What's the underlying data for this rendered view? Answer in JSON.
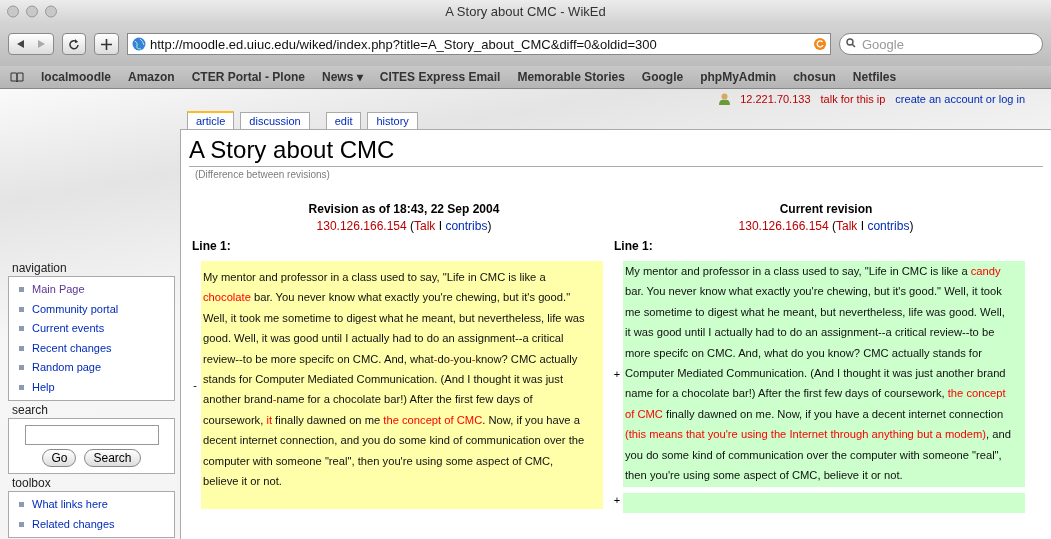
{
  "window": {
    "title": "A Story about CMC - WikEd"
  },
  "toolbar": {
    "url": "http://moodle.ed.uiuc.edu/wiked/index.php?title=A_Story_about_CMC&diff=0&oldid=300",
    "search": {
      "placeholder": "Google"
    }
  },
  "bookmarks": [
    "localmoodle",
    "Amazon",
    "CTER Portal - Plone",
    "News ▾",
    "CITES Express Email",
    "Memorable Stories",
    "Google",
    "phpMyAdmin",
    "chosun",
    "Netfiles"
  ],
  "user_bar": {
    "ip": "12.221.70.133",
    "talk": "talk for this ip",
    "login": "create an account or log in"
  },
  "tabs": [
    {
      "label": "article",
      "selected": true
    },
    {
      "label": "discussion",
      "selected": false
    },
    {
      "label": "edit",
      "selected": false
    },
    {
      "label": "history",
      "selected": false
    }
  ],
  "title": "A Story about CMC",
  "subtitle": "(Difference between revisions)",
  "sidebar": [
    {
      "kind": "links",
      "title": "navigation",
      "items": [
        {
          "label": "Main Page",
          "visited": true
        },
        {
          "label": "Community portal",
          "visited": false
        },
        {
          "label": "Current events",
          "visited": false
        },
        {
          "label": "Recent changes",
          "visited": false
        },
        {
          "label": "Random page",
          "visited": false
        },
        {
          "label": "Help",
          "visited": false
        }
      ]
    },
    {
      "kind": "search",
      "title": "search",
      "buttons": [
        "Go",
        "Search"
      ]
    },
    {
      "kind": "links",
      "title": "toolbox",
      "items": [
        {
          "label": "What links here",
          "visited": false
        },
        {
          "label": "Related changes",
          "visited": false
        }
      ]
    }
  ],
  "diff": {
    "columns": [
      {
        "kind": "deleted",
        "heading": "Revision as of 18:43, 22 Sep 2004",
        "author": [
          {
            "text": "130.126.166.154",
            "kind": "new"
          },
          {
            "text": " (",
            "kind": "plain"
          },
          {
            "text": "Talk",
            "kind": "new"
          },
          {
            "text": " I ",
            "kind": "plain"
          },
          {
            "text": "contribs",
            "kind": "link"
          },
          {
            "text": ")",
            "kind": "plain"
          }
        ],
        "line_label": "Line 1:",
        "marker": "-",
        "segments": [
          {
            "text": "My mentor and professor in a class used to say, \"Life in CMC is like a ",
            "changed": false
          },
          {
            "text": "chocolate",
            "changed": true
          },
          {
            "text": " bar. You never know what exactly you're chewing, but it's good.\" Well, it took me sometime to digest what he meant, but nevertheless, life was good. Well, it was good until I actually had to do an assignment--a critical review--to be more specifc on CMC. And, what",
            "changed": false
          },
          {
            "text": "-",
            "changed": true
          },
          {
            "text": "do",
            "changed": false
          },
          {
            "text": "-",
            "changed": true
          },
          {
            "text": "you",
            "changed": false
          },
          {
            "text": "-",
            "changed": true
          },
          {
            "text": "know? CMC actually stands for Computer Mediated Communication. (And I thought it was just another brand",
            "changed": false
          },
          {
            "text": "-",
            "changed": true
          },
          {
            "text": "name for a chocolate bar!) After the first few days of coursework, ",
            "changed": false
          },
          {
            "text": "it",
            "changed": true
          },
          {
            "text": " finally dawned on me ",
            "changed": false
          },
          {
            "text": "the concept of CMC",
            "changed": true
          },
          {
            "text": ". Now, if you have a decent internet connection, and you do some kind of communication over the computer with someone \"real\", then you're using some aspect of CMC, believe it or not.",
            "changed": false
          }
        ]
      },
      {
        "kind": "added",
        "heading": "Current revision",
        "author": [
          {
            "text": "130.126.166.154",
            "kind": "new"
          },
          {
            "text": " (",
            "kind": "plain"
          },
          {
            "text": "Talk",
            "kind": "new"
          },
          {
            "text": " I ",
            "kind": "plain"
          },
          {
            "text": "contribs",
            "kind": "link"
          },
          {
            "text": ")",
            "kind": "plain"
          }
        ],
        "line_label": "Line 1:",
        "marker": "+",
        "segments": [
          {
            "text": "My mentor and professor in a class used to say, \"Life in CMC is like a ",
            "changed": false
          },
          {
            "text": "candy",
            "changed": true
          },
          {
            "text": " bar. You never know what exactly you're chewing, but it's good.\" Well, it took me sometime to digest what he meant, but nevertheless, life was good. Well, it was good until I actually had to do an assignment--a critical review--to be more specifc on CMC. And, what do you know? CMC actually stands for Computer Mediated Communication. (And I thought it was just another brand name for a chocolate bar!) After the first few days of coursework, ",
            "changed": false
          },
          {
            "text": "the concept of CMC",
            "changed": true
          },
          {
            "text": " finally dawned on me. Now, if you have a decent internet connection ",
            "changed": false
          },
          {
            "text": "(this means that you're using the Internet through anything but a modem)",
            "changed": true
          },
          {
            "text": ", and you do some kind of communication over the computer with someone \"real\", then you're using some aspect of CMC, believe it or not.",
            "changed": false
          }
        ]
      }
    ],
    "extra_marker": "+"
  }
}
